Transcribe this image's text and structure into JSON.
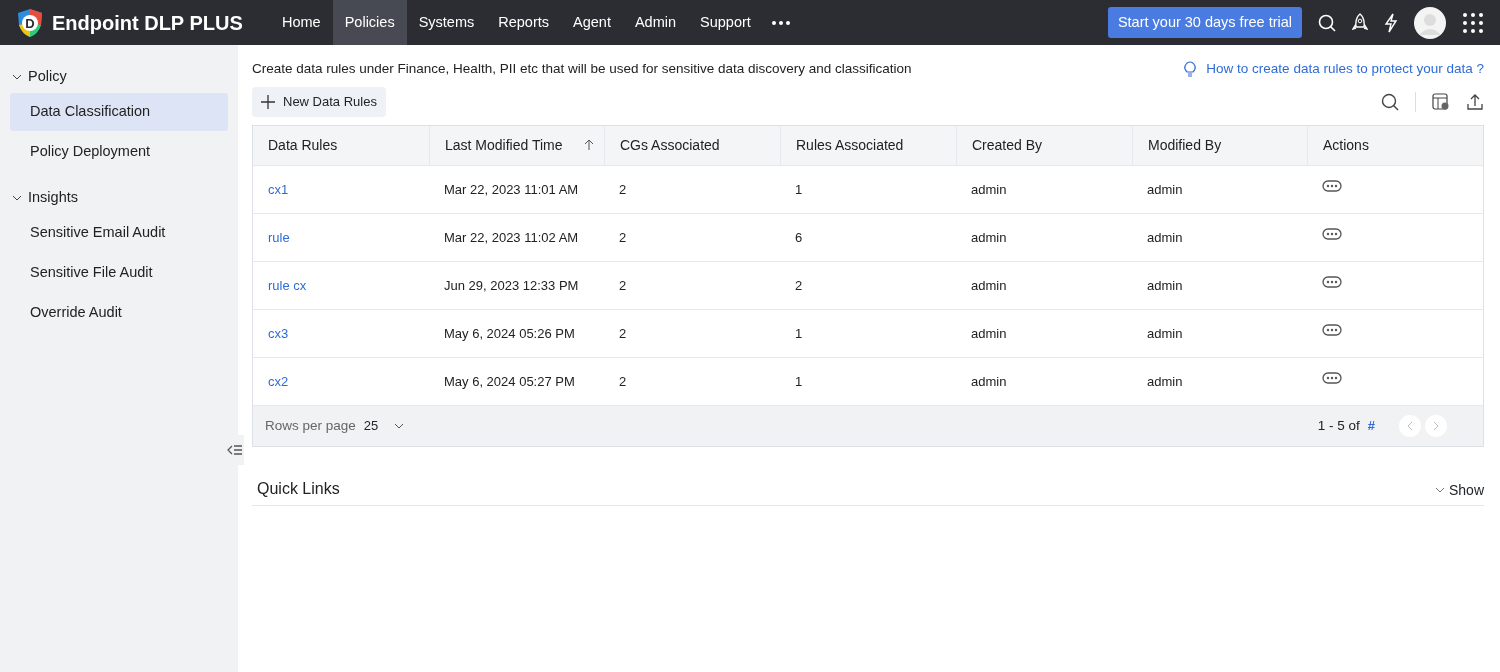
{
  "app": {
    "name": "Endpoint DLP PLUS",
    "logo_letter": "D"
  },
  "nav": [
    {
      "label": "Home",
      "selected": false
    },
    {
      "label": "Policies",
      "selected": true
    },
    {
      "label": "Systems",
      "selected": false
    },
    {
      "label": "Reports",
      "selected": false
    },
    {
      "label": "Agent",
      "selected": false
    },
    {
      "label": "Admin",
      "selected": false
    },
    {
      "label": "Support",
      "selected": false
    }
  ],
  "trial_button": "Start your 30 days free trial",
  "sidebar": [
    {
      "label": "Policy",
      "expanded": true,
      "children": [
        {
          "label": "Data Classification",
          "selected": true
        },
        {
          "label": "Policy Deployment",
          "selected": false
        }
      ]
    },
    {
      "label": "Insights",
      "expanded": true,
      "children": [
        {
          "label": "Sensitive Email Audit",
          "selected": false
        },
        {
          "label": "Sensitive File Audit",
          "selected": false
        },
        {
          "label": "Override Audit",
          "selected": false
        }
      ]
    }
  ],
  "description": "Create data rules under Finance, Health, PII etc that will be used for sensitive data discovery and classification",
  "help_link": "How to create data rules to protect your data ?",
  "new_button": "New Data Rules",
  "table": {
    "columns": [
      {
        "label": "Data Rules",
        "sorted": false
      },
      {
        "label": "Last Modified Time",
        "sorted": true
      },
      {
        "label": "CGs Associated",
        "sorted": false
      },
      {
        "label": "Rules Associated",
        "sorted": false
      },
      {
        "label": "Created By",
        "sorted": false
      },
      {
        "label": "Modified By",
        "sorted": false
      },
      {
        "label": "Actions",
        "sorted": false
      }
    ],
    "rows": [
      [
        "cx1",
        "Mar 22, 2023 11:01 AM",
        "2",
        "1",
        "admin",
        "admin"
      ],
      [
        "rule",
        "Mar 22, 2023 11:02 AM",
        "2",
        "6",
        "admin",
        "admin"
      ],
      [
        "rule cx",
        "Jun 29, 2023 12:33 PM",
        "2",
        "2",
        "admin",
        "admin"
      ],
      [
        "cx3",
        "May 6, 2024 05:26 PM",
        "2",
        "1",
        "admin",
        "admin"
      ],
      [
        "cx2",
        "May 6, 2024 05:27 PM",
        "2",
        "1",
        "admin",
        "admin"
      ]
    ]
  },
  "pagination": {
    "rows_label": "Rows per page",
    "rows_value": "25",
    "range": "1 - 5 of",
    "total": "#"
  },
  "quick_links": {
    "title": "Quick Links",
    "toggle": "Show",
    "expanded": false
  }
}
